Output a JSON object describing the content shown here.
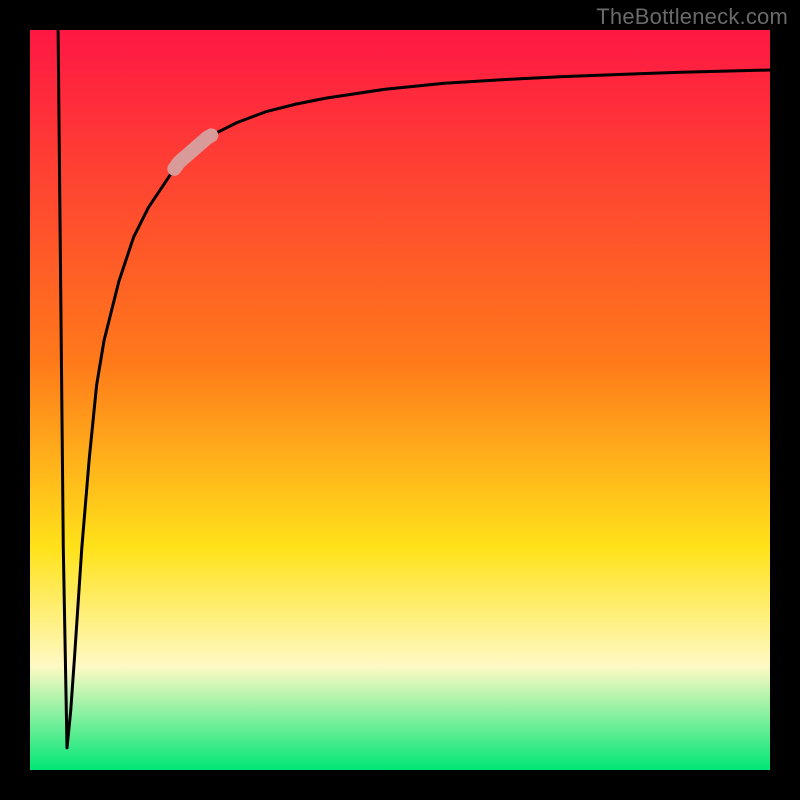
{
  "watermark": "TheBottleneck.com",
  "colors": {
    "frame": "#000000",
    "gradient_top": "#ff1744",
    "gradient_mid1": "#ff7a1a",
    "gradient_mid2": "#ffe21a",
    "gradient_mid3": "#fff9c4",
    "gradient_bottom": "#00e676",
    "curve": "#000000",
    "segment": "#d99a9a"
  },
  "chart_data": {
    "type": "line",
    "title": "",
    "xlabel": "",
    "ylabel": "",
    "xlim": [
      0,
      100
    ],
    "ylim": [
      0,
      100
    ],
    "series": [
      {
        "name": "curve",
        "x": [
          3.8,
          4.5,
          5.0,
          5.5,
          6.0,
          7.0,
          8.0,
          9.0,
          10.0,
          12.0,
          14.0,
          16.0,
          18.0,
          20.0,
          24.0,
          28.0,
          32.0,
          36.0,
          40.0,
          48.0,
          56.0,
          64.0,
          72.0,
          80.0,
          88.0,
          100.0
        ],
        "y": [
          100.0,
          30.0,
          3.0,
          8.0,
          15.0,
          30.0,
          42.0,
          52.0,
          58.0,
          66.0,
          72.0,
          76.0,
          79.0,
          82.0,
          85.5,
          87.5,
          89.0,
          90.0,
          90.8,
          92.0,
          92.8,
          93.3,
          93.7,
          94.0,
          94.3,
          94.6
        ]
      }
    ],
    "highlight_segment": {
      "x_start": 19.5,
      "x_end": 24.5
    },
    "notes": "y-values are bottleneck percentage: 100 at top of plot, 0 at bottom. The curve falls from near 100% at the left edge to a sharp minimum near x≈5 (~3%) then rises asymptotically toward ~95% on the right. A short pale-pink thick segment highlights roughly x∈[19.5,24.5]. No visible axis ticks or numeric labels are present in the image; all numeric values are read off the geometry relative to the plot frame."
  }
}
